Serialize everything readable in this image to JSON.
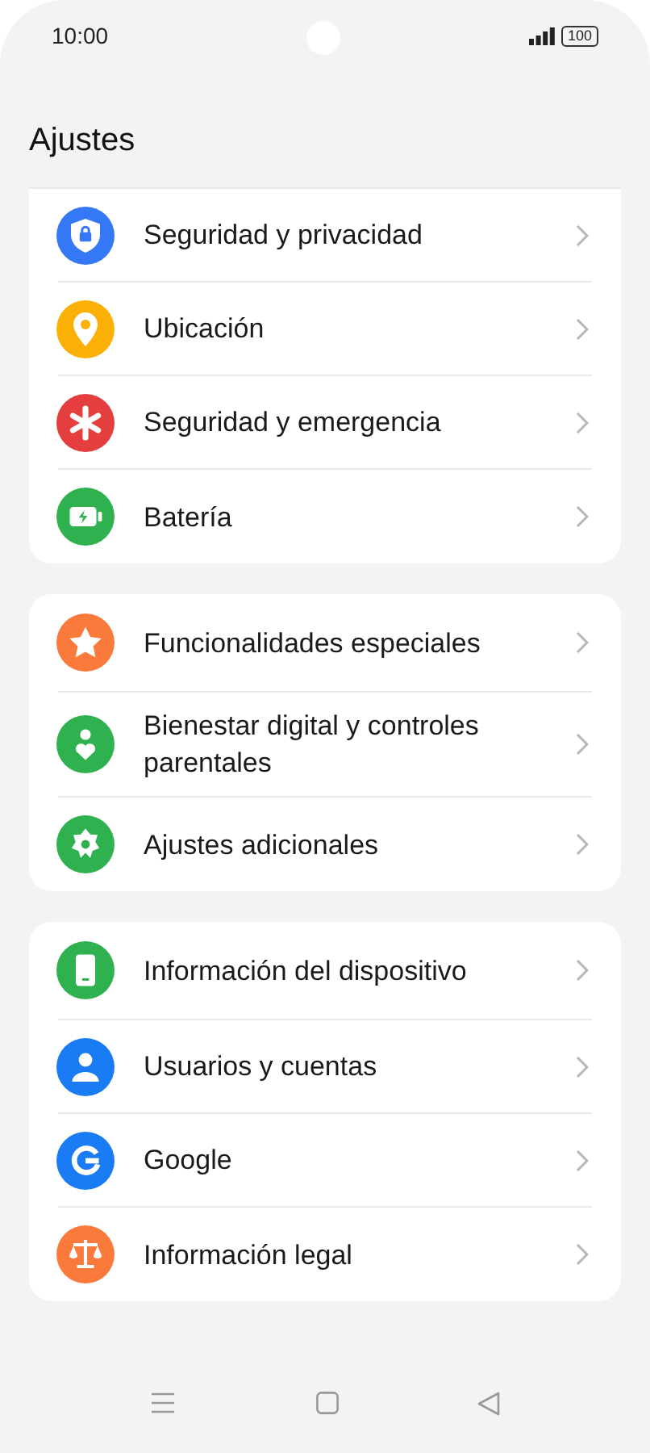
{
  "status_bar": {
    "time": "10:00",
    "battery": "100"
  },
  "title": "Ajustes",
  "groups": [
    {
      "items": [
        {
          "label": "Seguridad y privacidad",
          "kind": "shield",
          "color": "#3478f6"
        },
        {
          "label": "Ubicación",
          "kind": "pin",
          "color": "#fbb005"
        },
        {
          "label": "Seguridad y emergencia",
          "kind": "asterisk",
          "color": "#e53e3e"
        },
        {
          "label": "Batería",
          "kind": "battery",
          "color": "#2fb14f"
        }
      ]
    },
    {
      "items": [
        {
          "label": "Funcionalidades especiales",
          "kind": "star",
          "color": "#fa7a3c"
        },
        {
          "label": "Bienestar digital y controles parentales",
          "kind": "heart",
          "color": "#2fb14f"
        },
        {
          "label": "Ajustes adicionales",
          "kind": "gear",
          "color": "#2fb14f"
        }
      ]
    },
    {
      "items": [
        {
          "label": "Información del dispositivo",
          "kind": "phone",
          "color": "#2fb14f"
        },
        {
          "label": "Usuarios y cuentas",
          "kind": "person",
          "color": "#1a7cf5"
        },
        {
          "label": "Google",
          "kind": "google",
          "color": "#1a7cf5"
        },
        {
          "label": "Información legal",
          "kind": "scales",
          "color": "#fa7a3c"
        }
      ]
    }
  ]
}
